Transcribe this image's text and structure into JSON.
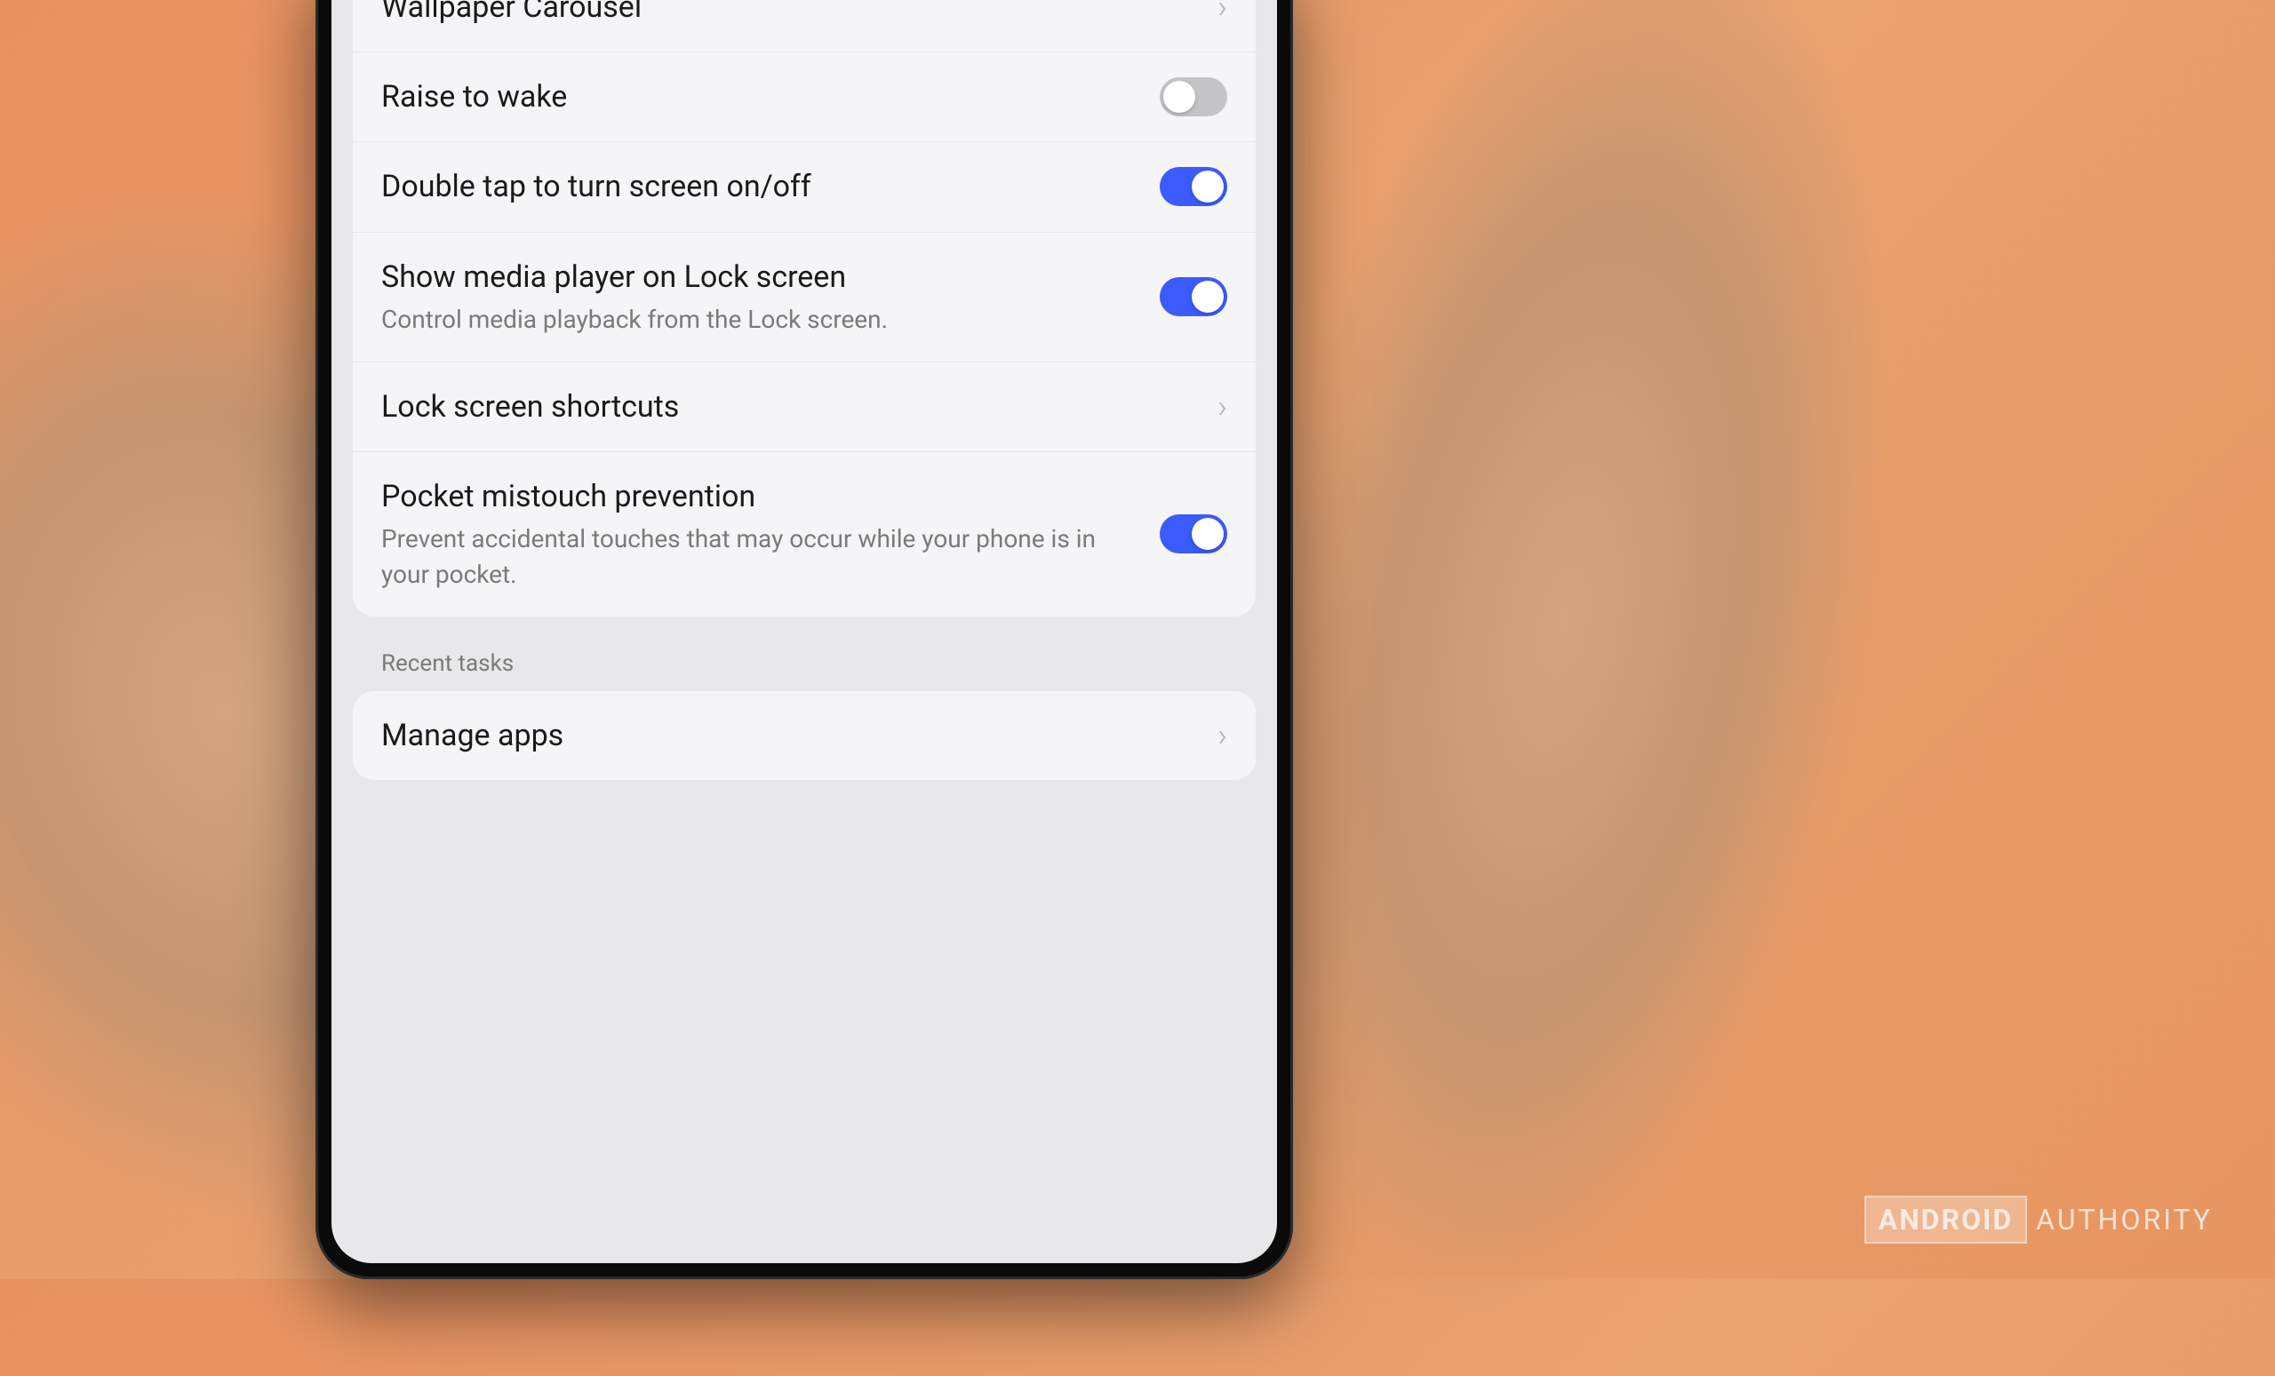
{
  "settings": {
    "card1": {
      "items": [
        {
          "title": "Wallpaper Carousel",
          "type": "nav"
        },
        {
          "title": "Raise to wake",
          "type": "toggle",
          "enabled": false
        },
        {
          "title": "Double tap to turn screen on/off",
          "type": "toggle",
          "enabled": true
        },
        {
          "title": "Show media player on Lock screen",
          "description": "Control media playback from the Lock screen.",
          "type": "toggle",
          "enabled": true
        },
        {
          "title": "Lock screen shortcuts",
          "type": "nav"
        },
        {
          "title": "Pocket mistouch prevention",
          "description": "Prevent accidental touches that may occur while your phone is in your pocket.",
          "type": "toggle",
          "enabled": true
        }
      ]
    },
    "section_recent_tasks": "Recent tasks",
    "card2": {
      "items": [
        {
          "title": "Manage apps",
          "type": "nav"
        }
      ]
    }
  },
  "watermark": {
    "brand_bold": "ANDROID",
    "brand_light": "AUTHORITY"
  },
  "colors": {
    "accent": "#3b5bff",
    "toggle_off": "#c4c4c6",
    "background": "#e8e8ea",
    "card_bg": "#f5f5f7"
  }
}
